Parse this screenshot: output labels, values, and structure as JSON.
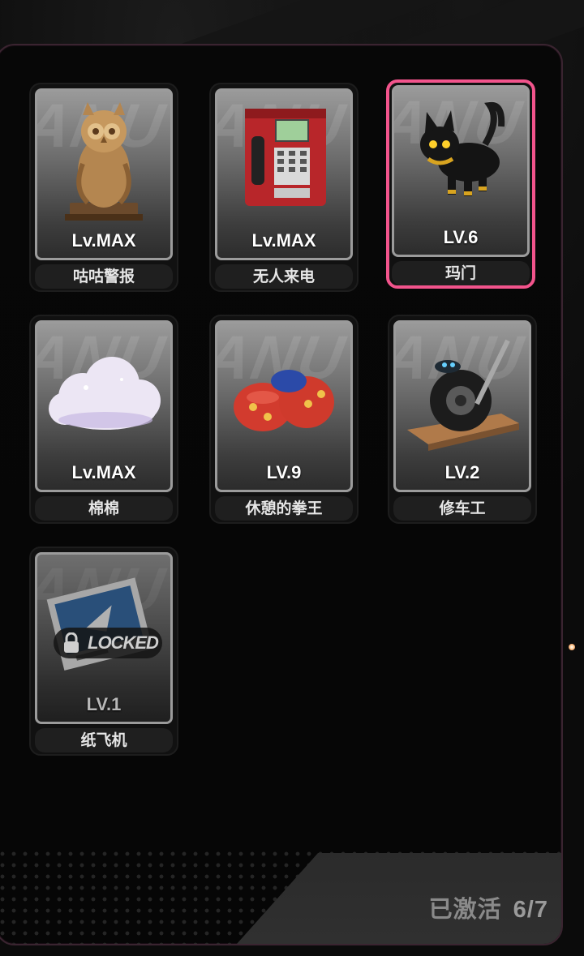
{
  "watermark": "ANU",
  "items": [
    {
      "name": "咕咕警报",
      "level": "Lv.MAX",
      "art": "owl-statue-icon",
      "selected": false,
      "locked": false
    },
    {
      "name": "无人来电",
      "level": "Lv.MAX",
      "art": "payphone-icon",
      "selected": false,
      "locked": false
    },
    {
      "name": "玛门",
      "level": "LV.6",
      "art": "black-cat-icon",
      "selected": true,
      "locked": false
    },
    {
      "name": "棉棉",
      "level": "Lv.MAX",
      "art": "cloud-icon",
      "selected": false,
      "locked": false
    },
    {
      "name": "休憩的拳王",
      "level": "LV.9",
      "art": "boxing-gloves-icon",
      "selected": false,
      "locked": false
    },
    {
      "name": "修车工",
      "level": "LV.2",
      "art": "tire-wrench-icon",
      "selected": false,
      "locked": false
    },
    {
      "name": "纸飞机",
      "level": "LV.1",
      "art": "paper-plane-photo-icon",
      "selected": false,
      "locked": true,
      "lock_label": "LOCKED"
    }
  ],
  "footer": {
    "label": "已激活",
    "count": "6/7"
  },
  "colors": {
    "selected_border": "#f2548c",
    "panel_border": "#3a2430"
  }
}
